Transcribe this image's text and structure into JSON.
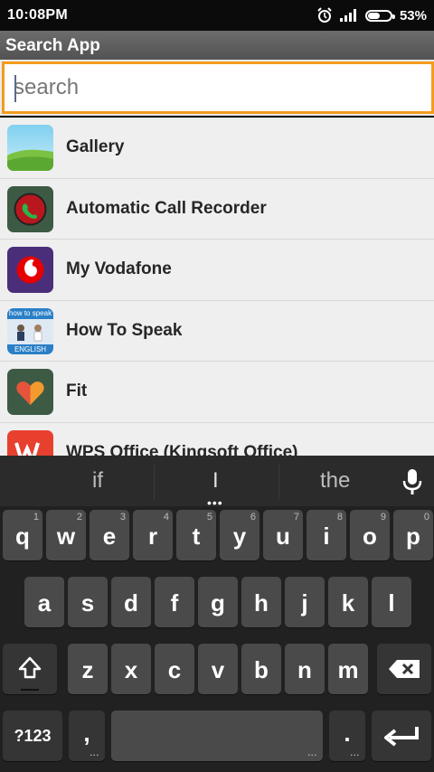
{
  "status_bar": {
    "time": "10:08PM",
    "battery": "53%",
    "battery_level": 0.53
  },
  "header": {
    "title": "Search App"
  },
  "search": {
    "placeholder": "search"
  },
  "apps": [
    {
      "label": "Gallery",
      "icon": "gallery-icon"
    },
    {
      "label": "Automatic Call Recorder",
      "icon": "call-recorder-icon"
    },
    {
      "label": "My Vodafone",
      "icon": "vodafone-icon"
    },
    {
      "label": "How To Speak",
      "icon": "how-to-speak-icon",
      "icon_text_top": "how to speak",
      "icon_text_bottom": "ENGLISH"
    },
    {
      "label": "Fit",
      "icon": "fit-heart-icon"
    },
    {
      "label": "WPS Office (Kingsoft Office)",
      "icon": "wps-office-icon"
    }
  ],
  "keyboard": {
    "suggestions": [
      "if",
      "I",
      "the"
    ],
    "row1": [
      {
        "key": "q",
        "hint": "1"
      },
      {
        "key": "w",
        "hint": "2"
      },
      {
        "key": "e",
        "hint": "3"
      },
      {
        "key": "r",
        "hint": "4"
      },
      {
        "key": "t",
        "hint": "5"
      },
      {
        "key": "y",
        "hint": "6"
      },
      {
        "key": "u",
        "hint": "7"
      },
      {
        "key": "i",
        "hint": "8"
      },
      {
        "key": "o",
        "hint": "9"
      },
      {
        "key": "p",
        "hint": "0"
      }
    ],
    "row2": [
      "a",
      "s",
      "d",
      "f",
      "g",
      "h",
      "j",
      "k",
      "l"
    ],
    "row3": [
      "z",
      "x",
      "c",
      "v",
      "b",
      "n",
      "m"
    ],
    "symbols_label": "?123",
    "comma_label": ",",
    "period_label": "."
  },
  "colors": {
    "accent": "#f39c1f",
    "keyboard_bg": "#212121",
    "key_bg": "#4a4a4a"
  }
}
